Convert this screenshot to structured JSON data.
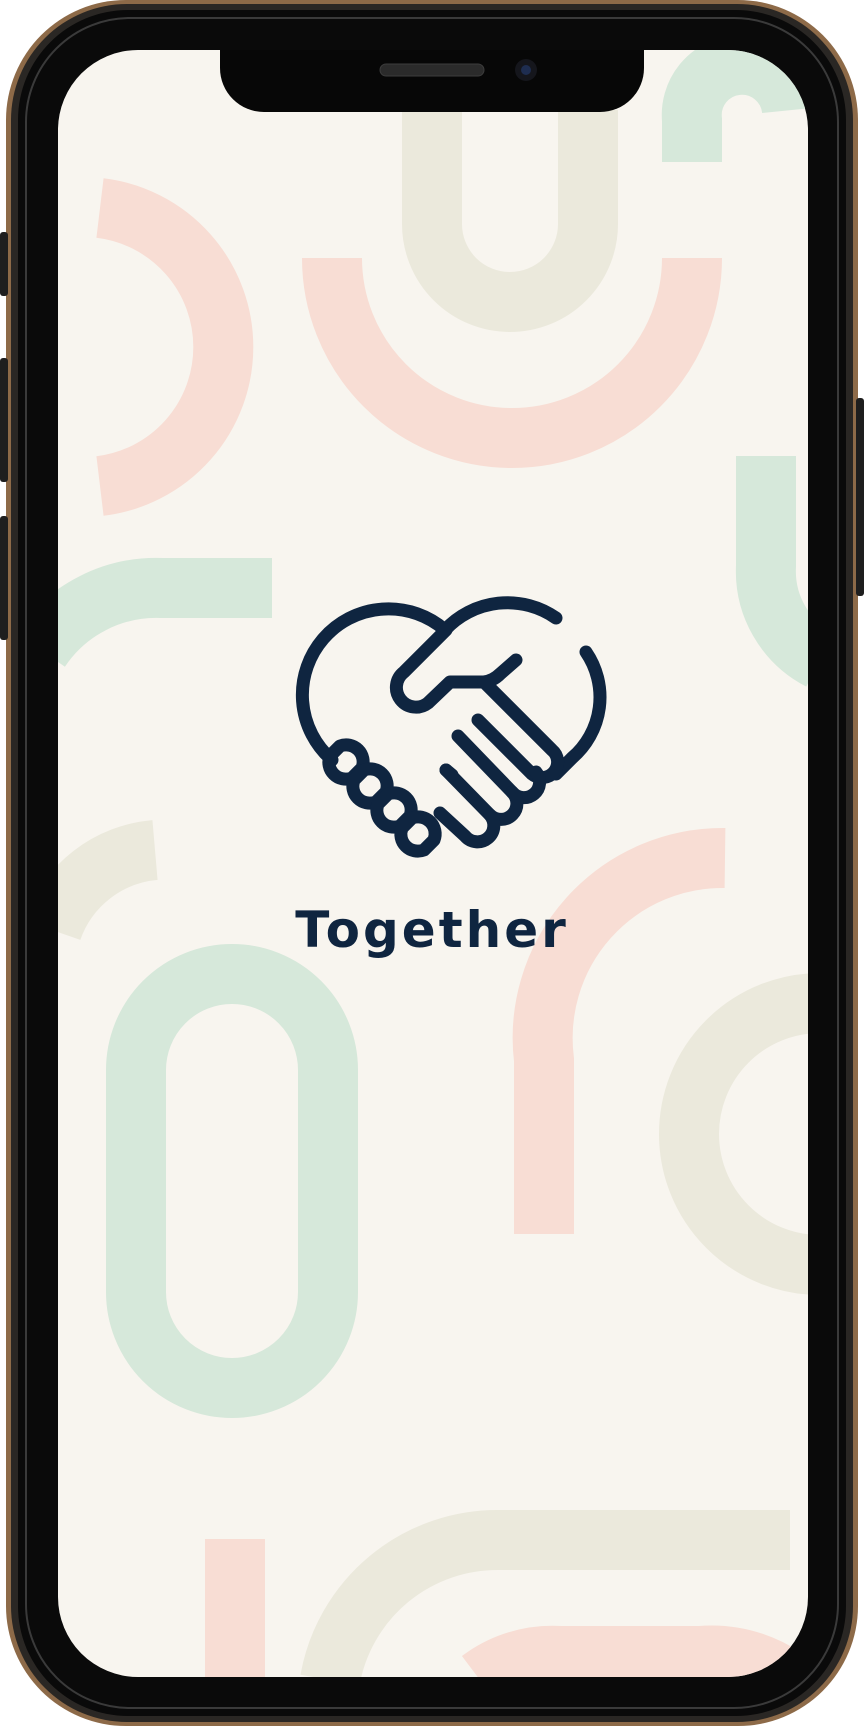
{
  "app": {
    "title": "Together",
    "logo_icon": "handshake-heart-icon"
  },
  "colors": {
    "screen_background": "#f8f5ef",
    "shape_pink": "#f8ddd4",
    "shape_green": "#d6e8da",
    "shape_beige": "#ebe9dc",
    "logo_navy": "#0f2540",
    "bezel": "#111111",
    "frame_gold": "#9a7450"
  }
}
